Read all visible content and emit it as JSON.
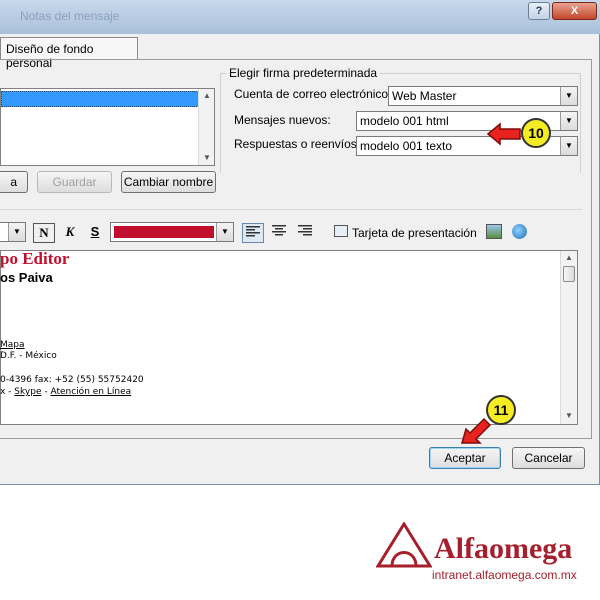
{
  "window": {
    "title": "Notas del mensaje",
    "help_label": "?",
    "close_label": "X"
  },
  "tab": {
    "label": "Diseño de fondo personal"
  },
  "signature_default": {
    "group_label": "Elegir firma predeterminada",
    "account_label": "Cuenta de correo electrónico:",
    "account_value": "Web Master",
    "new_messages_label": "Mensajes nuevos:",
    "new_messages_value": "modelo 001 html",
    "replies_label": "Respuestas o reenvíos:",
    "replies_value": "modelo 001 texto"
  },
  "buttons": {
    "left_partial": "a",
    "save": "Guardar",
    "rename": "Cambiar nombre",
    "accept": "Aceptar",
    "cancel": "Cancelar"
  },
  "toolbar": {
    "bold": "N",
    "italic": "K",
    "underline": "S",
    "business_card": "Tarjeta de presentación"
  },
  "colors": {
    "font_color": "#c0102d",
    "brand": "#a5202c",
    "callout": "#f5ec26",
    "pointer": "#e8231e"
  },
  "editor": {
    "title_line": "po Editor",
    "name_line": "os Paiva",
    "map_link": "Mapa",
    "city_line": "D.F. - México",
    "phone_line": "0-4396   fax: +52 (55) 55752420",
    "contact_prefix": "x - ",
    "skype_link": "Skype",
    "sep": " - ",
    "online_link": "Atención en Línea"
  },
  "callouts": {
    "step10": "10",
    "step11": "11"
  },
  "footer": {
    "brand": "Alfaomega",
    "url": "intranet.alfaomega.com.mx"
  }
}
